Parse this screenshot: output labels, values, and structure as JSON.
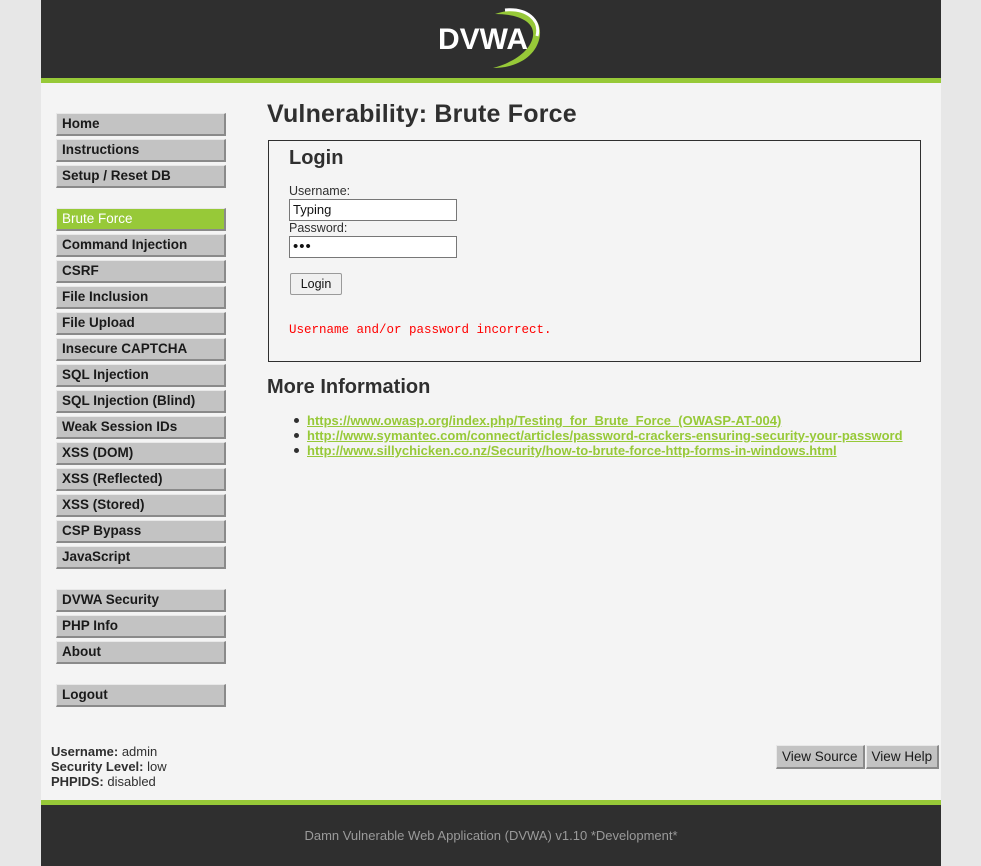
{
  "header": {
    "logo_text": "DVWA",
    "accent_color": "#97c938",
    "dark_color": "#2f2f2f"
  },
  "menu": {
    "group1": [
      {
        "label": "Home"
      },
      {
        "label": "Instructions"
      },
      {
        "label": "Setup / Reset DB"
      }
    ],
    "group2": [
      {
        "label": "Brute Force",
        "selected": true
      },
      {
        "label": "Command Injection"
      },
      {
        "label": "CSRF"
      },
      {
        "label": "File Inclusion"
      },
      {
        "label": "File Upload"
      },
      {
        "label": "Insecure CAPTCHA"
      },
      {
        "label": "SQL Injection"
      },
      {
        "label": "SQL Injection (Blind)"
      },
      {
        "label": "Weak Session IDs"
      },
      {
        "label": "XSS (DOM)"
      },
      {
        "label": "XSS (Reflected)"
      },
      {
        "label": "XSS (Stored)"
      },
      {
        "label": "CSP Bypass"
      },
      {
        "label": "JavaScript"
      }
    ],
    "group3": [
      {
        "label": "DVWA Security"
      },
      {
        "label": "PHP Info"
      },
      {
        "label": "About"
      }
    ],
    "group4": [
      {
        "label": "Logout"
      }
    ]
  },
  "main": {
    "title": "Vulnerability: Brute Force",
    "login": {
      "heading": "Login",
      "username_label": "Username:",
      "username_value": "Typing",
      "password_label": "Password:",
      "password_value": "•••",
      "button_label": "Login",
      "error": "Username and/or password incorrect."
    },
    "more_info": {
      "heading": "More Information",
      "links": [
        "https://www.owasp.org/index.php/Testing_for_Brute_Force_(OWASP-AT-004)",
        "http://www.symantec.com/connect/articles/password-crackers-ensuring-security-your-password",
        "http://www.sillychicken.co.nz/Security/how-to-brute-force-http-forms-in-windows.html"
      ]
    }
  },
  "system_info": {
    "username_label": "Username:",
    "username": "admin",
    "security_label": "Security Level:",
    "security": "low",
    "phpids_label": "PHPIDS:",
    "phpids": "disabled"
  },
  "buttons": {
    "view_source": "View Source",
    "view_help": "View Help"
  },
  "footer": {
    "text": "Damn Vulnerable Web Application (DVWA) v1.10 *Development*"
  }
}
